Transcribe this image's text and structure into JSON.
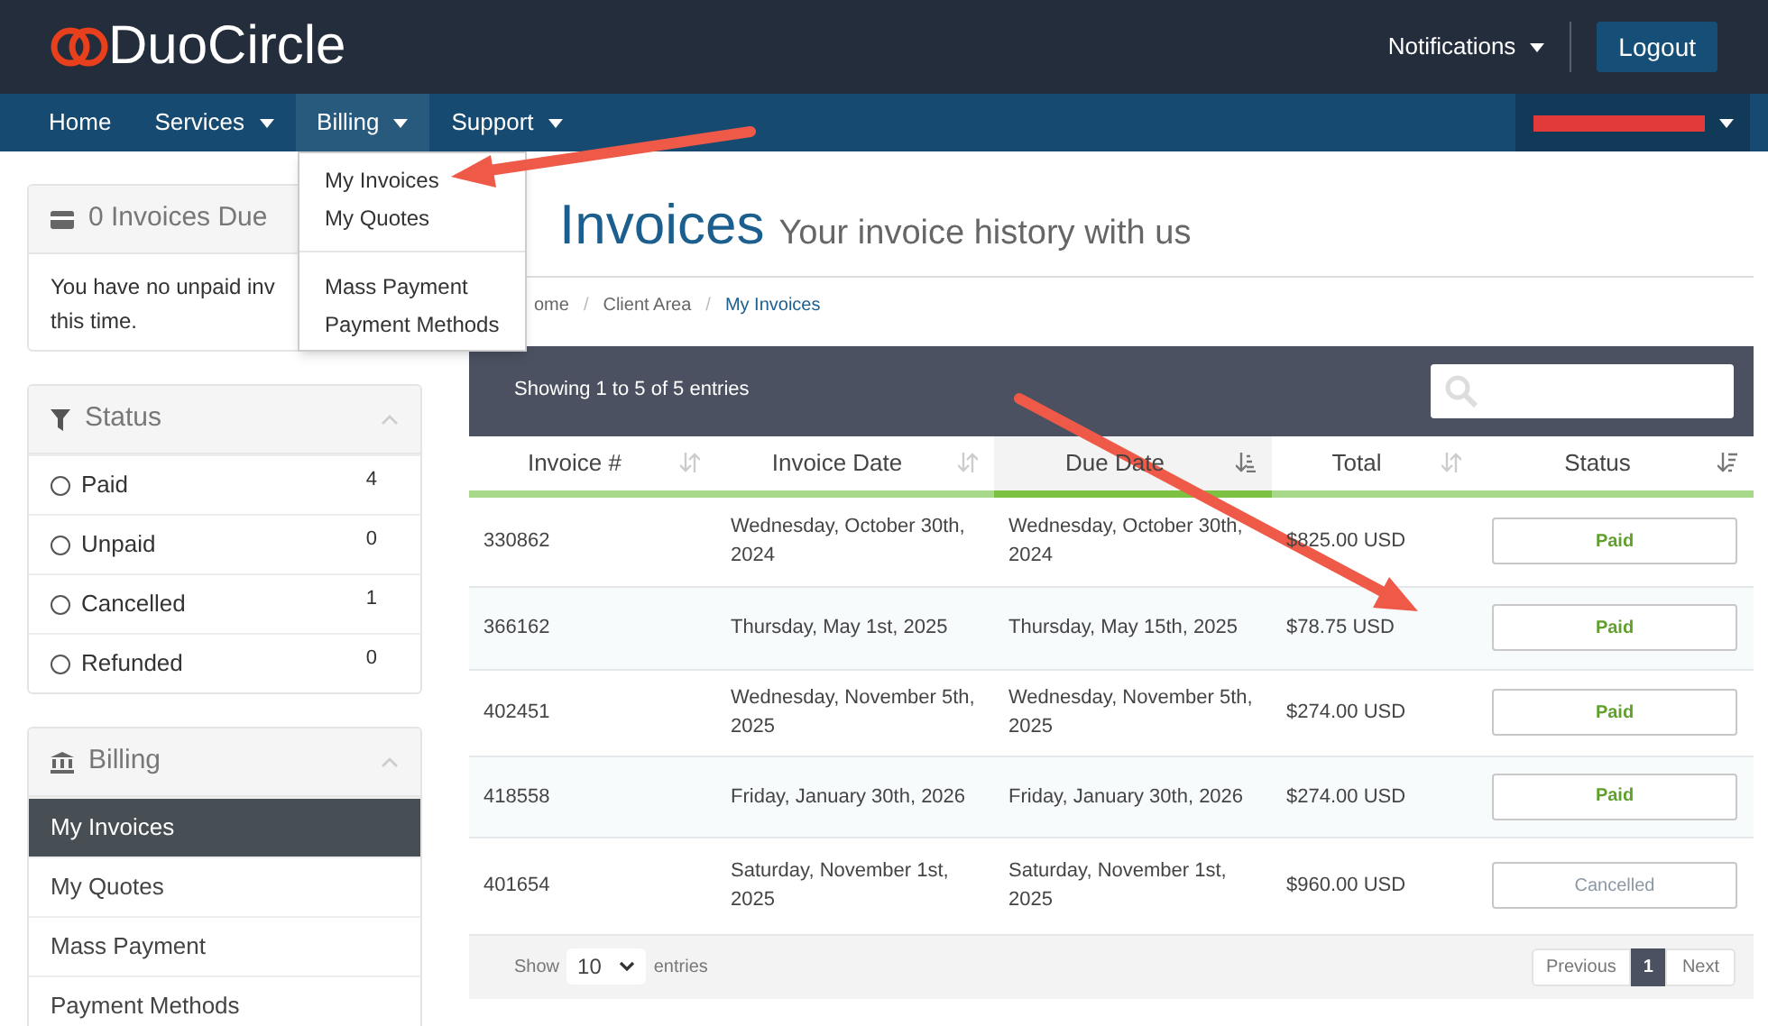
{
  "header": {
    "logo": "DuoCircle",
    "notifications": "Notifications",
    "logout": "Logout"
  },
  "nav": {
    "items": [
      {
        "label": "Home",
        "dropdown": false,
        "selected": false
      },
      {
        "label": "Services",
        "dropdown": true,
        "selected": false
      },
      {
        "label": "Billing",
        "dropdown": true,
        "selected": true
      },
      {
        "label": "Support",
        "dropdown": true,
        "selected": false
      }
    ],
    "user_menu": {
      "redacted": true
    }
  },
  "billing_dropdown": {
    "groups": [
      [
        "My Invoices",
        "My Quotes"
      ],
      [
        "Mass Payment",
        "Payment Methods"
      ]
    ]
  },
  "sidebar": {
    "due_panel": {
      "title": "0 Invoices Due",
      "lines": [
        "You have no unpaid inv",
        "this time."
      ]
    },
    "status_panel": {
      "title": "Status",
      "filters": [
        {
          "label": "Paid",
          "count": "4",
          "selected": false
        },
        {
          "label": "Unpaid",
          "count": "0",
          "selected": false
        },
        {
          "label": "Cancelled",
          "count": "1",
          "selected": false
        },
        {
          "label": "Refunded",
          "count": "0",
          "selected": false
        }
      ]
    },
    "billing_panel": {
      "title": "Billing",
      "items": [
        {
          "label": "My Invoices",
          "selected": true
        },
        {
          "label": "My Quotes",
          "selected": false
        },
        {
          "label": "Mass Payment",
          "selected": false
        },
        {
          "label": "Payment Methods",
          "selected": false
        }
      ]
    }
  },
  "page": {
    "title": "Invoices",
    "subtitle": "Your invoice history with us",
    "breadcrumb": [
      {
        "text": "ome",
        "kind": "link"
      },
      {
        "text": "/",
        "kind": "separator"
      },
      {
        "text": "Client Area",
        "kind": "link"
      },
      {
        "text": "/",
        "kind": "separator"
      },
      {
        "text": "My Invoices",
        "kind": "current"
      }
    ]
  },
  "table": {
    "info": "Showing 1 to 5 of 5 entries",
    "columns": [
      {
        "label": "Invoice #",
        "kind": "sortable",
        "sorted": false
      },
      {
        "label": "Invoice Date",
        "kind": "sortable",
        "sorted": false
      },
      {
        "label": "Due Date",
        "kind": "ascending",
        "sorted": true
      },
      {
        "label": "Total",
        "kind": "sortable",
        "sorted": false
      },
      {
        "label": "Status",
        "kind": "descending",
        "sorted": false
      }
    ],
    "rows": [
      {
        "cells": [
          "330862",
          "Wednesday, October 30th, 2024",
          "Wednesday, October 30th, 2024",
          "$825.00 USD"
        ],
        "status": "Paid",
        "kind": "paid"
      },
      {
        "cells": [
          "366162",
          "Thursday, May 1st, 2025",
          "Thursday, May 15th, 2025",
          "$78.75 USD"
        ],
        "status": "Paid",
        "kind": "paid"
      },
      {
        "cells": [
          "402451",
          "Wednesday, November 5th, 2025",
          "Wednesday, November 5th, 2025",
          "$274.00 USD"
        ],
        "status": "Paid",
        "kind": "paid"
      },
      {
        "cells": [
          "418558",
          "Friday, January 30th, 2026",
          "Friday, January 30th, 2026",
          "$274.00 USD"
        ],
        "status": "Paid",
        "kind": "paid"
      },
      {
        "cells": [
          "401654",
          "Saturday, November 1st, 2025",
          "Saturday, November 1st, 2025",
          "$960.00 USD"
        ],
        "status": "Cancelled",
        "kind": "cancelled"
      }
    ],
    "footer": {
      "show": "Show",
      "page_size": "10",
      "entries": "entries",
      "previous": "Previous",
      "page": "1",
      "next": "Next"
    }
  }
}
